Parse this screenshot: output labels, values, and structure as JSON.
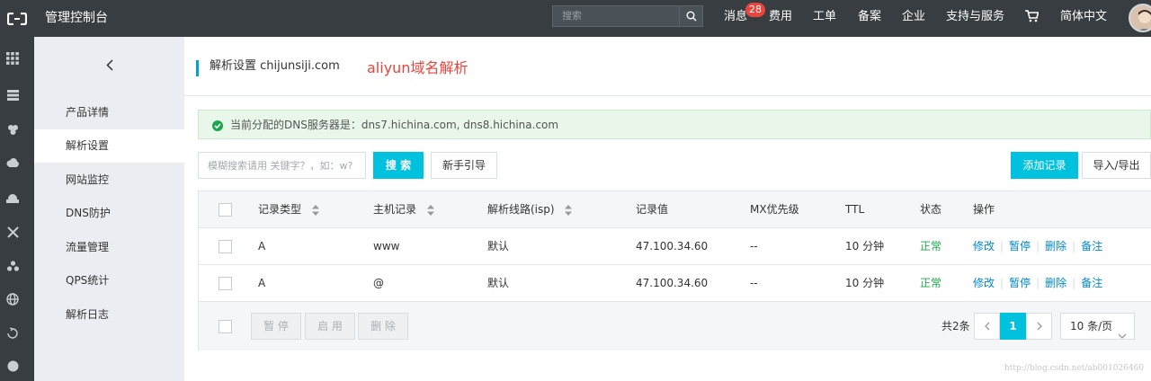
{
  "topbar": {
    "brand": "管理控制台",
    "search_placeholder": "搜索",
    "nav": [
      "消息",
      "费用",
      "工单",
      "备案",
      "企业",
      "支持与服务",
      "简体中文"
    ],
    "message_badge": "28"
  },
  "sidebar": {
    "items": [
      {
        "label": "产品详情"
      },
      {
        "label": "解析设置",
        "active": true
      },
      {
        "label": "网站监控"
      },
      {
        "label": "DNS防护"
      },
      {
        "label": "流量管理"
      },
      {
        "label": "QPS统计"
      },
      {
        "label": "解析日志"
      }
    ]
  },
  "header": {
    "title": "解析设置 chijunsiji.com",
    "annotation": "aliyun域名解析"
  },
  "alert": {
    "text": "当前分配的DNS服务器是：dns7.hichina.com, dns8.hichina.com"
  },
  "toolbar": {
    "search_placeholder": "模糊搜索请用 关键字？，如：w?",
    "search_label": "搜 索",
    "guide_label": "新手引导",
    "add_label": "添加记录",
    "import_label": "导入/导出"
  },
  "table": {
    "columns": [
      "记录类型",
      "主机记录",
      "解析线路(isp)",
      "记录值",
      "MX优先级",
      "TTL",
      "状态",
      "操作"
    ],
    "rows": [
      {
        "type": "A",
        "host": "www",
        "line": "默认",
        "value": "47.100.34.60",
        "mx": "--",
        "ttl": "10 分钟",
        "status": "正常"
      },
      {
        "type": "A",
        "host": "@",
        "line": "默认",
        "value": "47.100.34.60",
        "mx": "--",
        "ttl": "10 分钟",
        "status": "正常"
      }
    ],
    "actions": [
      "修改",
      "暂停",
      "删除",
      "备注"
    ]
  },
  "footer": {
    "pause_label": "暂 停",
    "enable_label": "启 用",
    "delete_label": "删 除",
    "total": "共2条",
    "current_page": "1",
    "page_size": "10 条/页"
  },
  "watermark": "http://blog.csdn.net/ab001026460",
  "colors": {
    "topbar": "#373d41",
    "accent": "#00c1de",
    "success": "#1ca74e",
    "badge": "#e8453c",
    "link": "#0088cc"
  }
}
